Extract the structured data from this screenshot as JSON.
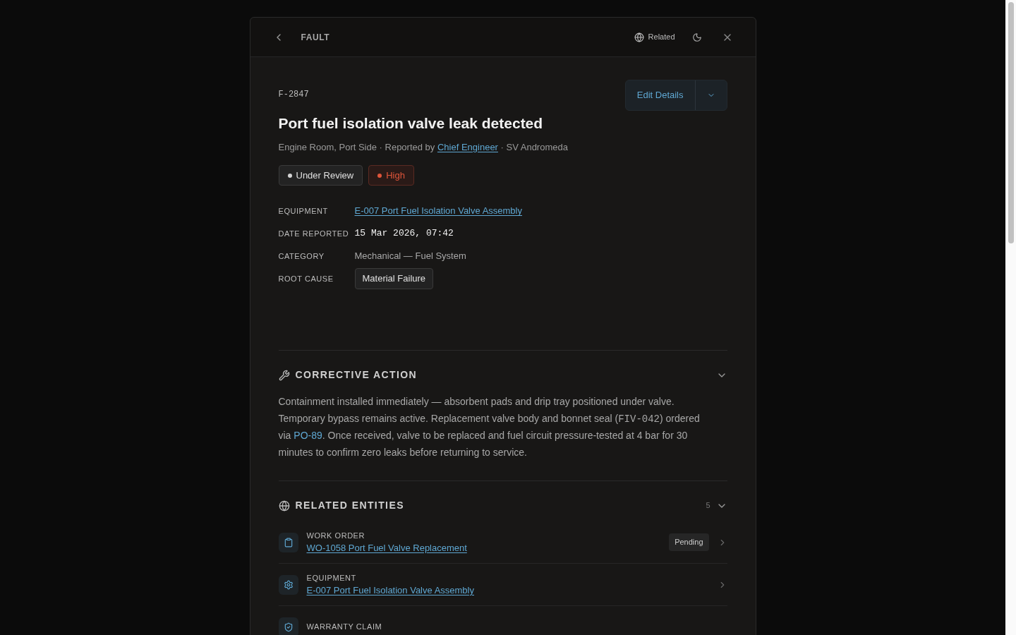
{
  "header": {
    "title": "FAULT",
    "related": "Related"
  },
  "fault": {
    "id": "F-2847",
    "title": "Port fuel isolation valve leak detected",
    "location": "Engine Room, Port Side · Reported by ",
    "reporter": "Chief Engineer",
    "vessel": " · SV Andromeda",
    "edit": "Edit Details"
  },
  "badges": [
    {
      "label": "Under Review",
      "color": "#d4d4d4",
      "kind": "status"
    },
    {
      "label": "High",
      "color": "#e0553a",
      "kind": "priority"
    }
  ],
  "fields": [
    {
      "label": "EQUIPMENT",
      "value": "E-007 Port Fuel Isolation Valve Assembly",
      "kind": "link"
    },
    {
      "label": "DATE REPORTED",
      "value": "15 Mar 2026, 07:42",
      "kind": "mono"
    },
    {
      "label": "CATEGORY",
      "value": "Mechanical — Fuel System",
      "kind": "text"
    },
    {
      "label": "ROOT CAUSE",
      "value": "Material Failure",
      "kind": "tag"
    }
  ],
  "corrective_action": {
    "title": "CORRECTIVE ACTION",
    "expanded": true,
    "before": "Containment installed immediately — absorbent pads and drip tray positioned under valve. Temporary bypass remains active. Replacement valve body and bonnet seal (",
    "code": "FIV-042",
    "middle": ") ordered via ",
    "link": "PO-89",
    "after": ". Once received, valve to be replaced and fuel circuit pressure-tested at 4 bar for 30 minutes to confirm zero leaks before returning to service."
  },
  "related": {
    "title": "RELATED ENTITIES",
    "count": "5",
    "expanded": true,
    "items": [
      {
        "kind": "work_order",
        "type": "WORK ORDER",
        "link": "WO-1058 Port Fuel Valve Replacement",
        "status": "Pending"
      },
      {
        "kind": "equipment",
        "type": "EQUIPMENT",
        "link": "E-007 Port Fuel Isolation Valve Assembly"
      },
      {
        "kind": "warranty",
        "type": "WARRANTY CLAIM"
      }
    ]
  }
}
